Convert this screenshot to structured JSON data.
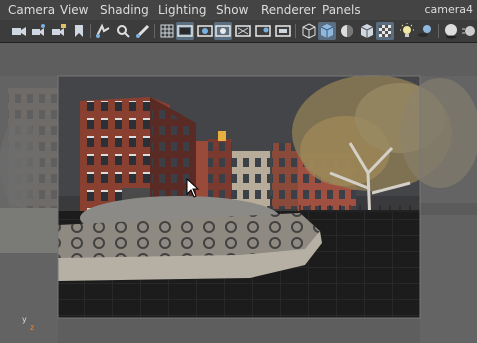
{
  "menu": {
    "items": [
      "Camera",
      "View",
      "Shading",
      "Lighting",
      "Show",
      "Renderer",
      "Panels"
    ],
    "camera_name": "camera4"
  },
  "toolbar": {
    "icons": [
      "camera-select-icon",
      "camera-attributes-icon",
      "bookmark-icon",
      "image-plane-icon",
      "grid-icon",
      "film-gate-icon",
      "resolution-gate-icon",
      "gate-mask-icon",
      "field-chart-icon",
      "safe-action-icon",
      "wireframe-icon",
      "smooth-shade-icon",
      "default-material-icon",
      "textured-icon",
      "xray-icon",
      "lighting-icon",
      "shadows-icon",
      "screen-space-ao-icon"
    ]
  },
  "viewport": {
    "axis_y_label": "y",
    "axis_z_label": "z"
  },
  "colors": {
    "menubar": "#444444",
    "toolbar": "#3c3c3c",
    "viewport_bg": "#5d5d5d",
    "active_button": "#5a6e82",
    "menu_text": "#dddddd"
  }
}
